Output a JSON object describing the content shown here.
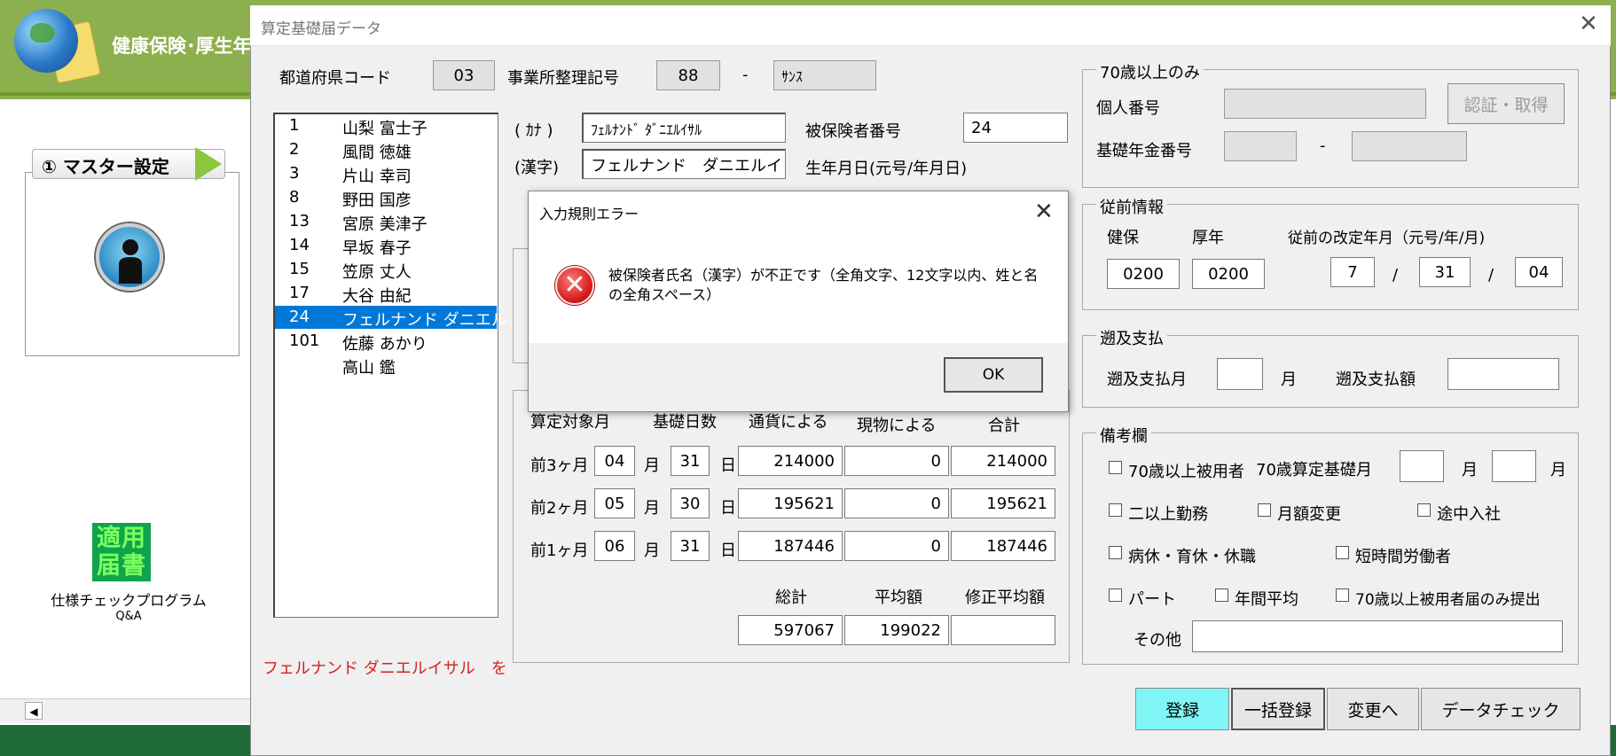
{
  "app": {
    "title": "健康保険･厚生年"
  },
  "left_panel": {
    "step_label": "① マスター設定",
    "program_label": "仕様チェックプログラム",
    "qa_label": "Q&A",
    "tekiyo_icon_text": "適用届書"
  },
  "window": {
    "title": "算定基礎届データ"
  },
  "header": {
    "pref_code_label": "都道府県コード",
    "pref_code_value": "03",
    "office_label": "事業所整理記号",
    "office_value1": "88",
    "dash": "-",
    "office_value2": "ｻﾝｽ"
  },
  "list": {
    "items": [
      {
        "no": "1",
        "name": "山梨 富士子"
      },
      {
        "no": "2",
        "name": "風間 徳雄"
      },
      {
        "no": "3",
        "name": "片山 幸司"
      },
      {
        "no": "8",
        "name": "野田 国彦"
      },
      {
        "no": "13",
        "name": "宮原 美津子"
      },
      {
        "no": "14",
        "name": "早坂 春子"
      },
      {
        "no": "15",
        "name": "笠原 丈人"
      },
      {
        "no": "17",
        "name": "大谷 由紀"
      },
      {
        "no": "24",
        "name": "フェルナンド ダニエル"
      },
      {
        "no": "101",
        "name": "佐藤 あかり"
      },
      {
        "no": "",
        "name": "高山 鑑"
      }
    ]
  },
  "person": {
    "kana_label": "( ｶﾅ )",
    "kana_value": "ﾌｪﾙﾅﾝﾄﾞ ﾀﾞﾆｴﾙｲｻﾙ",
    "kanji_label": "(漢字)",
    "kanji_value": "フェルナンド　ダニエルイ",
    "insured_no_label": "被保険者番号",
    "insured_no_value": "24",
    "birth_label": "生年月日(元号/年月日)"
  },
  "calc": {
    "col_headers": {
      "month": "算定対象月",
      "days": "基礎日数",
      "currency": "通貨による",
      "kind": "現物による",
      "total": "合計"
    },
    "rows": [
      {
        "label": "前3ヶ月",
        "month": "04",
        "month_unit": "月",
        "days": "31",
        "day_unit": "日",
        "currency": "214000",
        "kind": "0",
        "total": "214000"
      },
      {
        "label": "前2ヶ月",
        "month": "05",
        "month_unit": "月",
        "days": "30",
        "day_unit": "日",
        "currency": "195621",
        "kind": "0",
        "total": "195621"
      },
      {
        "label": "前1ヶ月",
        "month": "06",
        "month_unit": "月",
        "days": "31",
        "day_unit": "日",
        "currency": "187446",
        "kind": "0",
        "total": "187446"
      }
    ],
    "sum_labels": {
      "total": "総計",
      "average": "平均額",
      "adjusted": "修正平均額"
    },
    "sum_values": {
      "total": "597067",
      "average": "199022",
      "adjusted": ""
    }
  },
  "over70": {
    "legend": "70歳以上のみ",
    "personal_no_label": "個人番号",
    "auth_button": "認証・取得",
    "pension_label": "基礎年金番号",
    "dash": "-"
  },
  "previous": {
    "legend": "従前情報",
    "kenpo_label": "健保",
    "kosei_label": "厚年",
    "revision_label": "従前の改定年月（元号/年/月)",
    "kenpo_value": "0200",
    "kosei_value": "0200",
    "era_value": "7",
    "year_value": "31",
    "month_value": "04",
    "slash": "/"
  },
  "retro": {
    "legend": "遡及支払",
    "month_label": "遡及支払月",
    "month_unit": "月",
    "amount_label": "遡及支払額"
  },
  "remarks": {
    "legend": "備考欄",
    "over70_insured": "70歳以上被用者",
    "over70_base_month": "70歳算定基礎月",
    "month_unit": "月",
    "multiple_work": "二以上勤務",
    "monthly_change": "月額変更",
    "mid_join": "途中入社",
    "leave": "病休・育休・休職",
    "short_time": "短時間労働者",
    "part": "パート",
    "annual_avg": "年間平均",
    "over70_only": "70歳以上被用者届のみ提出",
    "other_label": "その他"
  },
  "buttons": {
    "register": "登録",
    "bulk_register": "一括登録",
    "to_change": "変更へ",
    "data_check": "データチェック"
  },
  "status_message": "フェルナンド ダニエルイサル　を",
  "dialog": {
    "title": "入力規則エラー",
    "message": "被保険者氏名（漢字）が不正です（全角文字、12文字以内、姓と名の全角スペース）",
    "ok": "OK"
  },
  "colors": {
    "header_green": "#8cb04d",
    "selection_blue": "#0078d7",
    "register_button": "#7ff5f5",
    "status_red": "#d62020"
  }
}
